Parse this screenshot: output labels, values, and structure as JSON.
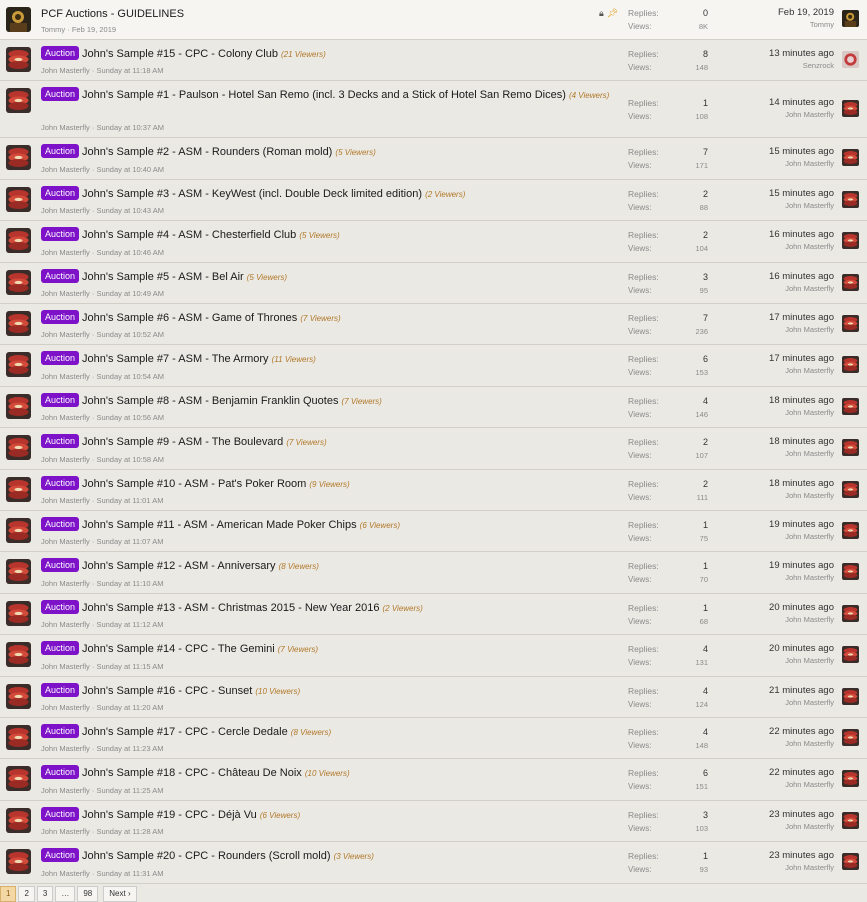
{
  "threads": [
    {
      "badge": "",
      "title": "PCF Auctions - GUIDELINES",
      "viewers": "",
      "author": "Tommy",
      "started": "Feb 19, 2019",
      "replies_label": "Replies:",
      "replies": "0",
      "views_label": "Views:",
      "views": "8K",
      "last_time": "Feb 19, 2019",
      "last_user": "Tommy",
      "sticky": true,
      "last_avatar": "tommy"
    },
    {
      "badge": "Auction",
      "title": "John's Sample #15 - CPC - Colony Club",
      "viewers": "(21 Viewers)",
      "author": "John Masterfly",
      "started": "Sunday at 11:18 AM",
      "replies_label": "Replies:",
      "replies": "8",
      "views_label": "Views:",
      "views": "148",
      "last_time": "13 minutes ago",
      "last_user": "Senzrock",
      "last_avatar": "senz"
    },
    {
      "badge": "Auction",
      "title": "John's Sample #1 - Paulson - Hotel San Remo (incl. 3 Decks and a Stick of Hotel San Remo Dices)",
      "viewers": "(4 Viewers)",
      "author": "John Masterfly",
      "started": "Sunday at 10:37 AM",
      "replies_label": "Replies:",
      "replies": "1",
      "views_label": "Views:",
      "views": "108",
      "last_time": "14 minutes ago",
      "last_user": "John Masterfly",
      "tall": true,
      "last_avatar": "john"
    },
    {
      "badge": "Auction",
      "title": "John's Sample #2 - ASM - Rounders (Roman mold)",
      "viewers": "(5 Viewers)",
      "author": "John Masterfly",
      "started": "Sunday at 10:40 AM",
      "replies_label": "Replies:",
      "replies": "7",
      "views_label": "Views:",
      "views": "171",
      "last_time": "15 minutes ago",
      "last_user": "John Masterfly",
      "last_avatar": "john"
    },
    {
      "badge": "Auction",
      "title": "John's Sample #3 - ASM - KeyWest (incl. Double Deck limited edition)",
      "viewers": "(2 Viewers)",
      "author": "John Masterfly",
      "started": "Sunday at 10:43 AM",
      "replies_label": "Replies:",
      "replies": "2",
      "views_label": "Views:",
      "views": "88",
      "last_time": "15 minutes ago",
      "last_user": "John Masterfly",
      "last_avatar": "john"
    },
    {
      "badge": "Auction",
      "title": "John's Sample #4 - ASM - Chesterfield Club",
      "viewers": "(5 Viewers)",
      "author": "John Masterfly",
      "started": "Sunday at 10:46 AM",
      "replies_label": "Replies:",
      "replies": "2",
      "views_label": "Views:",
      "views": "104",
      "last_time": "16 minutes ago",
      "last_user": "John Masterfly",
      "last_avatar": "john"
    },
    {
      "badge": "Auction",
      "title": "John's Sample #5 - ASM - Bel Air",
      "viewers": "(5 Viewers)",
      "author": "John Masterfly",
      "started": "Sunday at 10:49 AM",
      "replies_label": "Replies:",
      "replies": "3",
      "views_label": "Views:",
      "views": "95",
      "last_time": "16 minutes ago",
      "last_user": "John Masterfly",
      "last_avatar": "john"
    },
    {
      "badge": "Auction",
      "title": "John's Sample #6 - ASM - Game of Thrones",
      "viewers": "(7 Viewers)",
      "author": "John Masterfly",
      "started": "Sunday at 10:52 AM",
      "replies_label": "Replies:",
      "replies": "7",
      "views_label": "Views:",
      "views": "236",
      "last_time": "17 minutes ago",
      "last_user": "John Masterfly",
      "last_avatar": "john"
    },
    {
      "badge": "Auction",
      "title": "John's Sample #7 - ASM - The Armory",
      "viewers": "(11 Viewers)",
      "author": "John Masterfly",
      "started": "Sunday at 10:54 AM",
      "replies_label": "Replies:",
      "replies": "6",
      "views_label": "Views:",
      "views": "153",
      "last_time": "17 minutes ago",
      "last_user": "John Masterfly",
      "last_avatar": "john"
    },
    {
      "badge": "Auction",
      "title": "John's Sample #8 - ASM - Benjamin Franklin Quotes",
      "viewers": "(7 Viewers)",
      "author": "John Masterfly",
      "started": "Sunday at 10:56 AM",
      "replies_label": "Replies:",
      "replies": "4",
      "views_label": "Views:",
      "views": "146",
      "last_time": "18 minutes ago",
      "last_user": "John Masterfly",
      "last_avatar": "john"
    },
    {
      "badge": "Auction",
      "title": "John's Sample #9 - ASM - The Boulevard",
      "viewers": "(7 Viewers)",
      "author": "John Masterfly",
      "started": "Sunday at 10:58 AM",
      "replies_label": "Replies:",
      "replies": "2",
      "views_label": "Views:",
      "views": "107",
      "last_time": "18 minutes ago",
      "last_user": "John Masterfly",
      "last_avatar": "john"
    },
    {
      "badge": "Auction",
      "title": "John's Sample #10 - ASM - Pat's Poker Room",
      "viewers": "(9 Viewers)",
      "author": "John Masterfly",
      "started": "Sunday at 11:01 AM",
      "replies_label": "Replies:",
      "replies": "2",
      "views_label": "Views:",
      "views": "111",
      "last_time": "18 minutes ago",
      "last_user": "John Masterfly",
      "last_avatar": "john"
    },
    {
      "badge": "Auction",
      "title": "John's Sample #11 - ASM - American Made Poker Chips",
      "viewers": "(6 Viewers)",
      "author": "John Masterfly",
      "started": "Sunday at 11:07 AM",
      "replies_label": "Replies:",
      "replies": "1",
      "views_label": "Views:",
      "views": "75",
      "last_time": "19 minutes ago",
      "last_user": "John Masterfly",
      "last_avatar": "john"
    },
    {
      "badge": "Auction",
      "title": "John's Sample #12 - ASM - Anniversary",
      "viewers": "(8 Viewers)",
      "author": "John Masterfly",
      "started": "Sunday at 11:10 AM",
      "replies_label": "Replies:",
      "replies": "1",
      "views_label": "Views:",
      "views": "70",
      "last_time": "19 minutes ago",
      "last_user": "John Masterfly",
      "last_avatar": "john"
    },
    {
      "badge": "Auction",
      "title": "John's Sample #13 - ASM - Christmas 2015 - New Year 2016",
      "viewers": "(2 Viewers)",
      "author": "John Masterfly",
      "started": "Sunday at 11:12 AM",
      "replies_label": "Replies:",
      "replies": "1",
      "views_label": "Views:",
      "views": "68",
      "last_time": "20 minutes ago",
      "last_user": "John Masterfly",
      "last_avatar": "john"
    },
    {
      "badge": "Auction",
      "title": "John's Sample #14 - CPC - The Gemini",
      "viewers": "(7 Viewers)",
      "author": "John Masterfly",
      "started": "Sunday at 11:15 AM",
      "replies_label": "Replies:",
      "replies": "4",
      "views_label": "Views:",
      "views": "131",
      "last_time": "20 minutes ago",
      "last_user": "John Masterfly",
      "last_avatar": "john"
    },
    {
      "badge": "Auction",
      "title": "John's Sample #16 - CPC - Sunset",
      "viewers": "(10 Viewers)",
      "author": "John Masterfly",
      "started": "Sunday at 11:20 AM",
      "replies_label": "Replies:",
      "replies": "4",
      "views_label": "Views:",
      "views": "124",
      "last_time": "21 minutes ago",
      "last_user": "John Masterfly",
      "last_avatar": "john"
    },
    {
      "badge": "Auction",
      "title": "John's Sample #17 - CPC - Cercle Dedale",
      "viewers": "(8 Viewers)",
      "author": "John Masterfly",
      "started": "Sunday at 11:23 AM",
      "replies_label": "Replies:",
      "replies": "4",
      "views_label": "Views:",
      "views": "148",
      "last_time": "22 minutes ago",
      "last_user": "John Masterfly",
      "last_avatar": "john"
    },
    {
      "badge": "Auction",
      "title": "John's Sample #18 - CPC - Château De Noix",
      "viewers": "(10 Viewers)",
      "author": "John Masterfly",
      "started": "Sunday at 11:25 AM",
      "replies_label": "Replies:",
      "replies": "6",
      "views_label": "Views:",
      "views": "151",
      "last_time": "22 minutes ago",
      "last_user": "John Masterfly",
      "last_avatar": "john"
    },
    {
      "badge": "Auction",
      "title": "John's Sample #19 - CPC - Déjà Vu",
      "viewers": "(6 Viewers)",
      "author": "John Masterfly",
      "started": "Sunday at 11:28 AM",
      "replies_label": "Replies:",
      "replies": "3",
      "views_label": "Views:",
      "views": "103",
      "last_time": "23 minutes ago",
      "last_user": "John Masterfly",
      "last_avatar": "john"
    },
    {
      "badge": "Auction",
      "title": "John's Sample #20 - CPC - Rounders (Scroll mold)",
      "viewers": "(3 Viewers)",
      "author": "John Masterfly",
      "started": "Sunday at 11:31 AM",
      "replies_label": "Replies:",
      "replies": "1",
      "views_label": "Views:",
      "views": "93",
      "last_time": "23 minutes ago",
      "last_user": "John Masterfly",
      "last_avatar": "john"
    }
  ],
  "pagination": {
    "pages": [
      "1",
      "2",
      "3",
      "…",
      "98"
    ],
    "current": "1",
    "next_label": "Next ›"
  },
  "colors": {
    "badge": "#7d12c9",
    "viewers": "#b0782a",
    "background": "#ebe9e3"
  },
  "sticky_icons": [
    "lock-icon",
    "pin-icon"
  ]
}
